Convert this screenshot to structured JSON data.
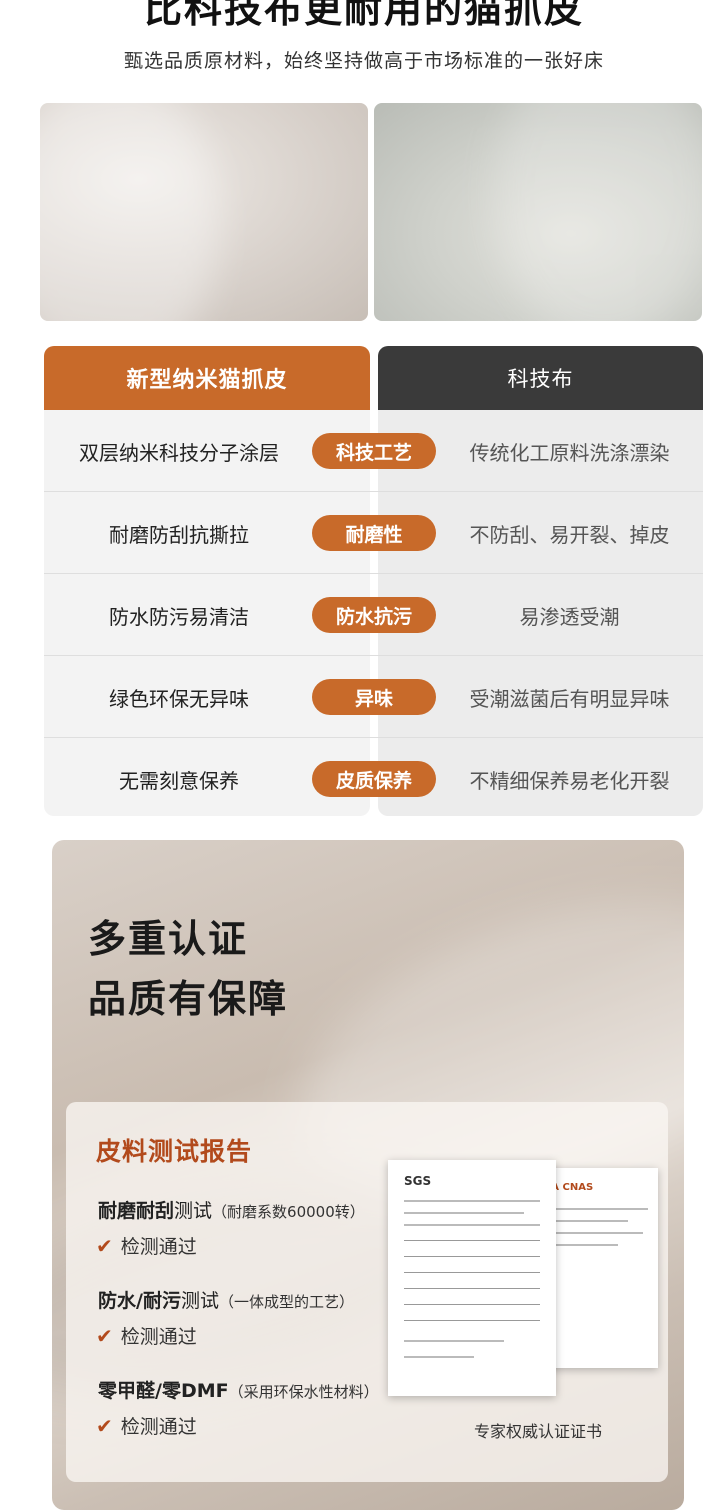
{
  "header": {
    "title": "比科技布更耐用的猫抓皮",
    "subtitle": "甄选品质原材料，始终坚持做高于市场标准的一张好床"
  },
  "comparison": {
    "left_title": "新型纳米猫抓皮",
    "right_title": "科技布",
    "rows": [
      {
        "left": "双层纳米科技分子涂层",
        "tag": "科技工艺",
        "right": "传统化工原料洗涤漂染"
      },
      {
        "left": "耐磨防刮抗撕拉",
        "tag": "耐磨性",
        "right": "不防刮、易开裂、掉皮"
      },
      {
        "left": "防水防污易清洁",
        "tag": "防水抗污",
        "right": "易渗透受潮"
      },
      {
        "left": "绿色环保无异味",
        "tag": "异味",
        "right": "受潮滋菌后有明显异味"
      },
      {
        "left": "无需刻意保养",
        "tag": "皮质保养",
        "right": "不精细保养易老化开裂"
      }
    ],
    "accent_color": "#c86a2a",
    "dark_color": "#3a3a3a"
  },
  "certification": {
    "title_line1": "多重认证",
    "title_line2": "品质有保障",
    "report_title": "皮料测试报告",
    "tests": [
      {
        "name_bold": "耐磨耐刮",
        "name_rest": "测试",
        "note": "（耐磨系数60000转）",
        "result": "检测通过"
      },
      {
        "name_bold": "防水/耐污",
        "name_rest": "测试",
        "note": "（一体成型的工艺）",
        "result": "检测通过"
      },
      {
        "name_bold": "零甲醛/零DMF",
        "name_rest": "",
        "note": "（采用环保水性材料）",
        "result": "检测通过"
      }
    ],
    "doc_logo": "SGS",
    "doc_logos_back": "CMA CNAS",
    "doc_caption": "专家权威认证证书",
    "report_title_color": "#b24a1c"
  }
}
